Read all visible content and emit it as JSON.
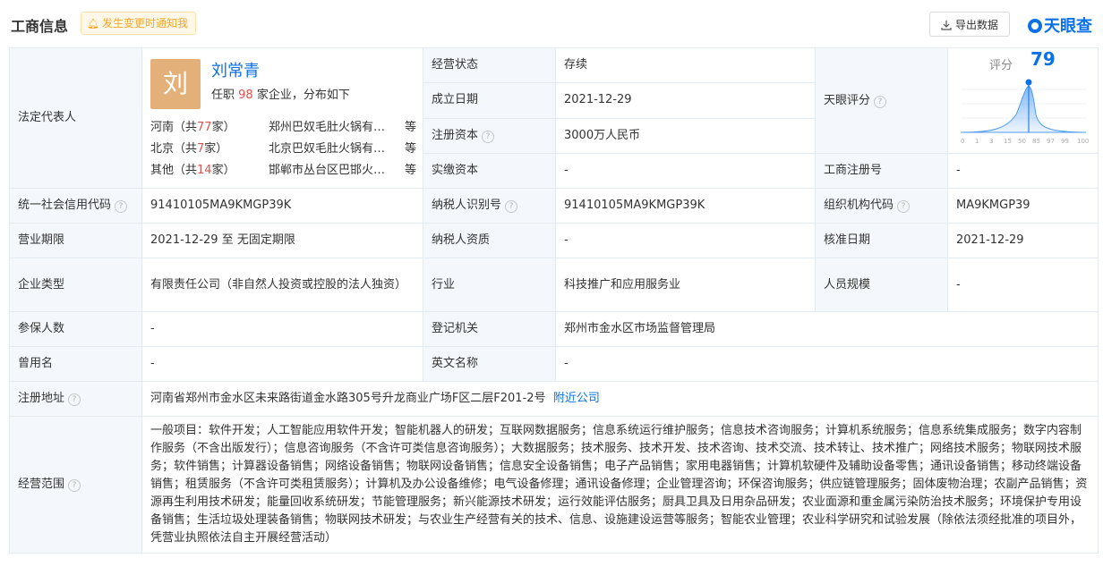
{
  "header": {
    "title": "工商信息",
    "notify_label": "发生变更时通知我",
    "export_label": "导出数据",
    "brand": "天眼查"
  },
  "legal_rep": {
    "label": "法定代表人",
    "avatar_char": "刘",
    "name": "刘常青",
    "summary_prefix": "任职",
    "company_count": "98",
    "summary_suffix": "家企业，分布如下",
    "regions": [
      {
        "region": "河南（共",
        "count": "77",
        "unit": "家）",
        "company": "郑州巴奴毛肚火锅有限公司",
        "more": "等"
      },
      {
        "region": "北京（共",
        "count": "7",
        "unit": "家）",
        "company": "北京巴奴毛肚火锅有限公司",
        "more": "等"
      },
      {
        "region": "其他（共",
        "count": "14",
        "unit": "家）",
        "company": "邯郸市丛台区巴邯火锅店",
        "more": "等"
      }
    ]
  },
  "score": {
    "label": "评分",
    "value": "79",
    "axis": [
      "0",
      "1",
      "3",
      "15",
      "50",
      "85",
      "97",
      "99",
      "100"
    ],
    "position": 0.62
  },
  "labels": {
    "status": "经营状态",
    "found_date": "成立日期",
    "reg_capital": "注册资本",
    "paid_capital": "实缴资本",
    "tianyan_score": "天眼评分",
    "biz_reg_no": "工商注册号",
    "credit_code": "统一社会信用代码",
    "taxpayer_id": "纳税人识别号",
    "org_code": "组织机构代码",
    "term": "营业期限",
    "taxpayer_qual": "纳税人资质",
    "approve_date": "核准日期",
    "company_type": "企业类型",
    "industry": "行业",
    "staff_size": "人员规模",
    "insured": "参保人数",
    "reg_authority": "登记机关",
    "former_name": "曾用名",
    "english_name": "英文名称",
    "address": "注册地址",
    "scope": "经营范围"
  },
  "values": {
    "status": "存续",
    "found_date": "2021-12-29",
    "reg_capital": "3000万人民币",
    "paid_capital": "-",
    "biz_reg_no": "-",
    "credit_code": "91410105MA9KMGP39K",
    "taxpayer_id": "91410105MA9KMGP39K",
    "org_code": "MA9KMGP39",
    "term": "2021-12-29 至 无固定期限",
    "taxpayer_qual": "-",
    "approve_date": "2021-12-29",
    "company_type": "有限责任公司（非自然人投资或控股的法人独资）",
    "industry": "科技推广和应用服务业",
    "staff_size": "-",
    "insured": "-",
    "reg_authority": "郑州市金水区市场监督管理局",
    "former_name": "-",
    "english_name": "-",
    "address": "河南省郑州市金水区未来路街道金水路305号升龙商业广场F区二层F201-2号",
    "nearby_link": "附近公司",
    "scope": "一般项目：软件开发；人工智能应用软件开发；智能机器人的研发；互联网数据服务；信息系统运行维护服务；信息技术咨询服务；计算机系统服务；信息系统集成服务；数字内容制作服务（不含出版发行）；信息咨询服务（不含许可类信息咨询服务）；大数据服务；技术服务、技术开发、技术咨询、技术交流、技术转让、技术推广；网络技术服务；物联网技术服务；软件销售；计算器设备销售；网络设备销售；物联网设备销售；信息安全设备销售；电子产品销售；家用电器销售；计算机软硬件及辅助设备零售；通讯设备销售；移动终端设备销售；租赁服务（不含许可类租赁服务）；计算机及办公设备维修；电气设备修理；通讯设备修理；企业管理咨询；环保咨询服务；供应链管理服务；固体废物治理；农副产品销售；资源再生利用技术研发；能量回收系统研发；节能管理服务；新兴能源技术研发；运行效能评估服务；厨具卫具及日用杂品研发；农业面源和重金属污染防治技术服务；环境保护专用设备销售；生活垃圾处理装备销售；物联网技术研发；与农业生产经营有关的技术、信息、设施建设运营等服务；智能农业管理；农业科学研究和试验发展（除依法须经批准的项目外，凭营业执照依法自主开展经营活动）"
  },
  "colors": {
    "accent": "#0a72e6",
    "label_bg": "#f4f8fd",
    "highlight": "#e0504d",
    "notify": "#f5a623"
  }
}
